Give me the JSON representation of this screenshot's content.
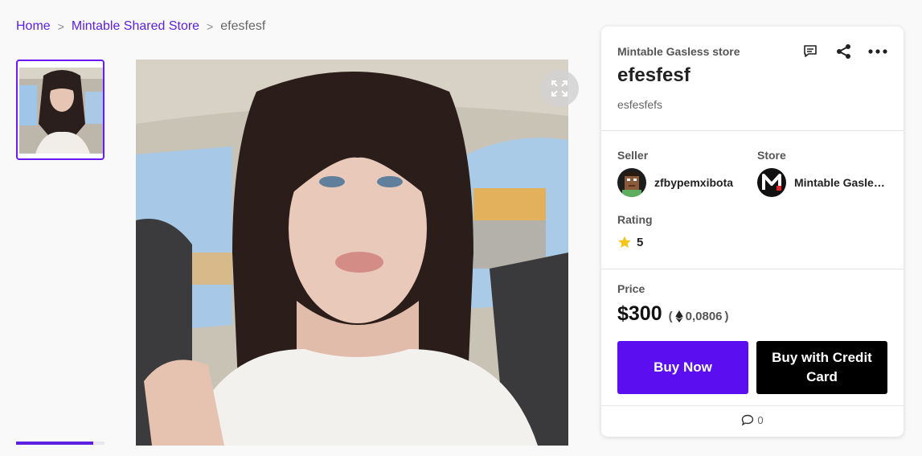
{
  "breadcrumb": {
    "home": "Home",
    "separator": ">",
    "store": "Mintable Shared Store",
    "current": "efesfesf"
  },
  "gallery": {
    "thumbnail_progress": 0.87,
    "accent_color": "#5d1fe0"
  },
  "item": {
    "store_name": "Mintable Gasless store",
    "title": "efesfesf",
    "description": "esfesfefs",
    "icons": [
      "comment-icon",
      "share-icon",
      "more-icon",
      "expand-icon"
    ]
  },
  "seller": {
    "label": "Seller",
    "name": "zfbypemxibota"
  },
  "store": {
    "label": "Store",
    "name": "Mintable Gasless store"
  },
  "rating": {
    "label": "Rating",
    "value": "5",
    "star_color": "#f5c518"
  },
  "price": {
    "label": "Price",
    "usd": "$300",
    "eth_open": "(",
    "eth": "0,0806",
    "eth_close": ")"
  },
  "buttons": {
    "buy_now": "Buy Now",
    "buy_card": "Buy with Credit Card",
    "buy_now_color": "#5b0ff0",
    "buy_card_color": "#000000"
  },
  "comments": {
    "count": "0"
  }
}
